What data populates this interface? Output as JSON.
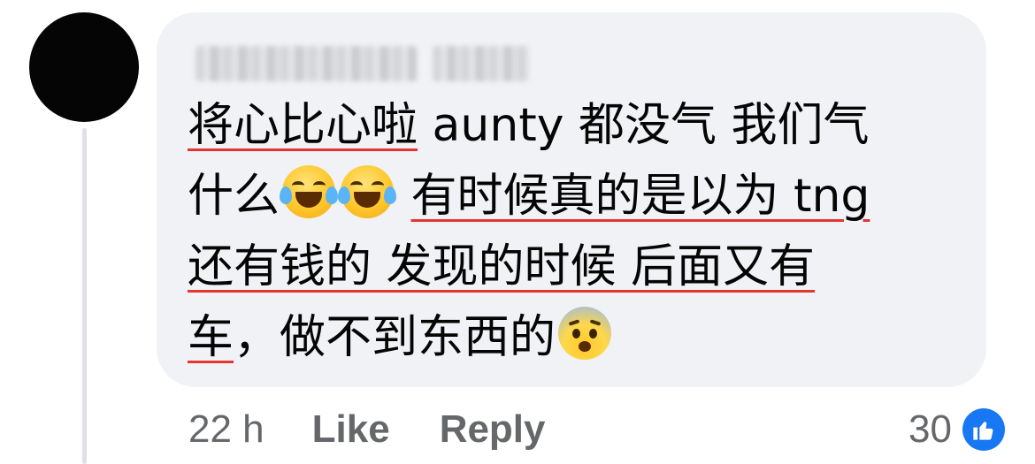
{
  "comment": {
    "lines": [
      [
        {
          "text": "将心比心啦",
          "u": true
        },
        {
          "text": " aunty 都没气 我们气",
          "u": false
        }
      ],
      [
        {
          "text": "什么",
          "u": false
        },
        {
          "emoji": "laughing-tears-icon"
        },
        {
          "emoji": "laughing-tears-icon"
        },
        {
          "text": " ",
          "u": false
        },
        {
          "text": "有时候真的是以为 tng",
          "u": true
        }
      ],
      [
        {
          "text": "还有钱的 发现的时候 后面又有",
          "u": true
        }
      ],
      [
        {
          "text": "车",
          "u": true
        },
        {
          "text": "，做不到东西的",
          "u": false
        },
        {
          "emoji": "fearful-face-icon"
        }
      ]
    ]
  },
  "meta": {
    "time": "22 h",
    "like_label": "Like",
    "reply_label": "Reply"
  },
  "reactions": {
    "count": "30",
    "icon": "thumbs-up-icon",
    "color": "#1877f2"
  },
  "colors": {
    "bubble": "#f0f2f5",
    "underline": "#e4352f",
    "meta_text": "#65676b"
  }
}
